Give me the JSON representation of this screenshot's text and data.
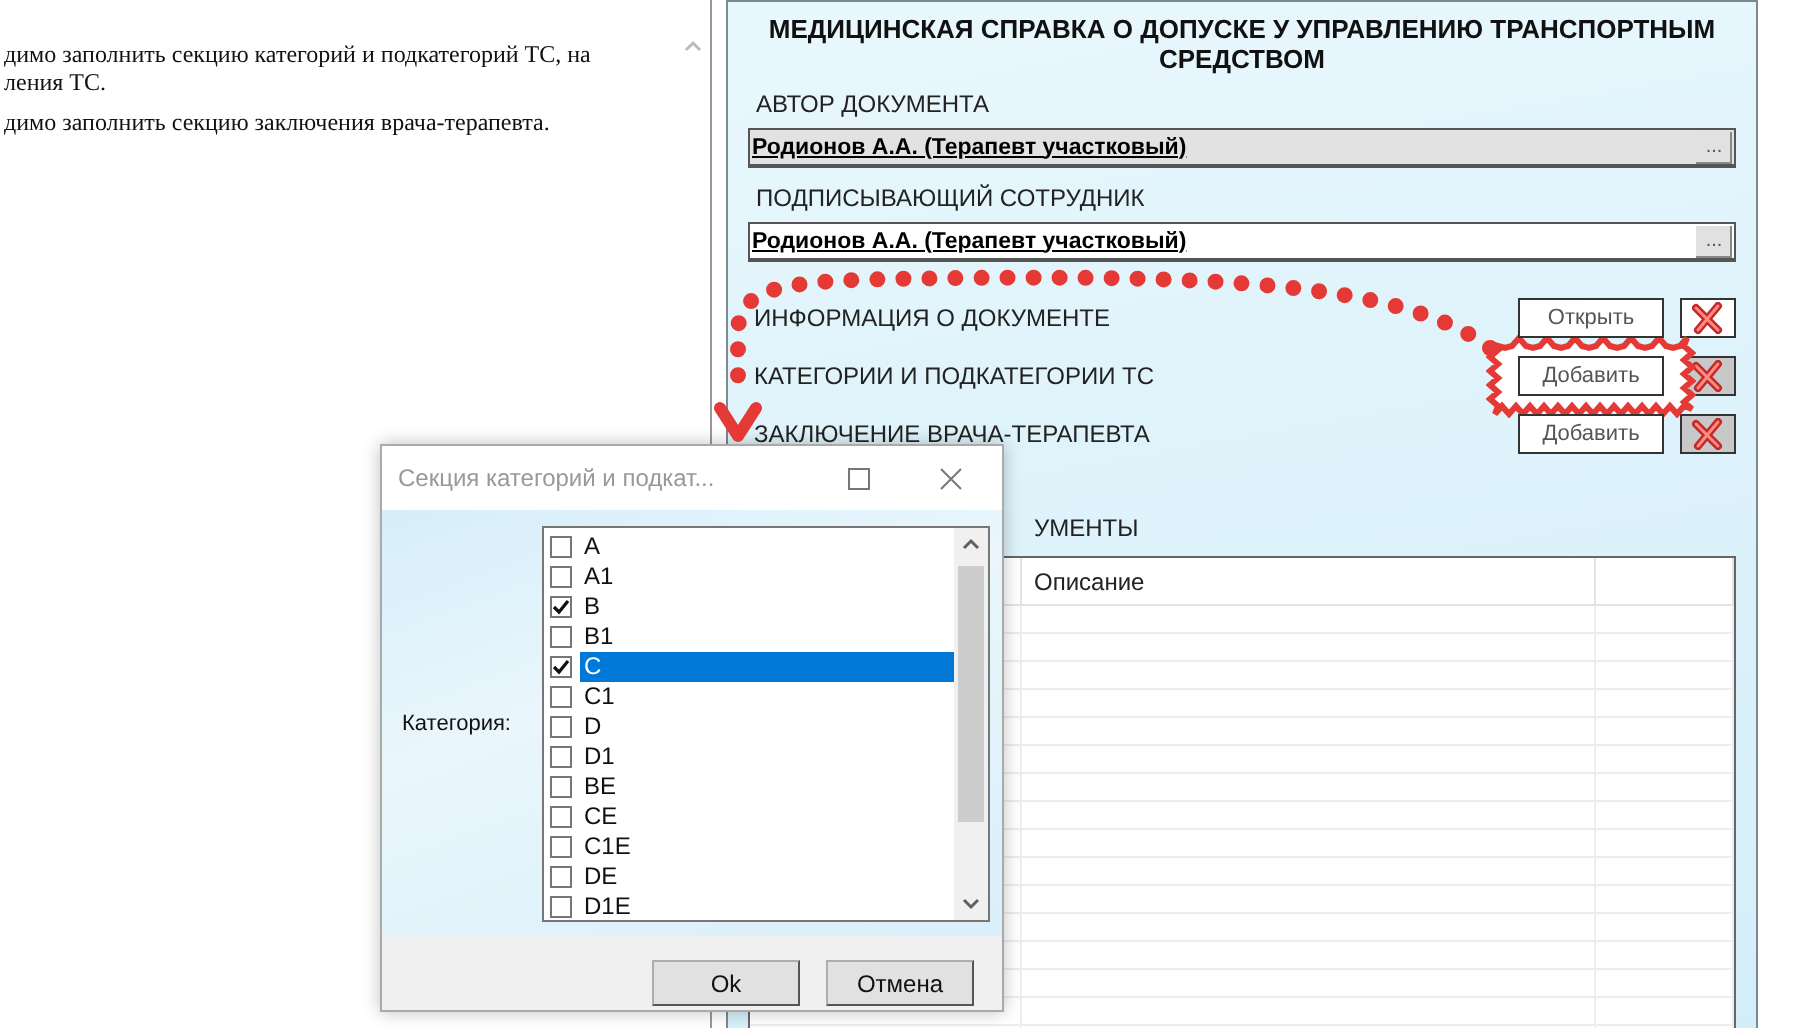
{
  "left_pane": {
    "lines": [
      "димо заполнить секцию категорий и подкатегорий ТС, на",
      "ления ТС.",
      "димо заполнить секцию заключения врача-терапевта."
    ]
  },
  "form": {
    "title": "МЕДИЦИНСКАЯ СПРАВКА О ДОПУСКЕ У УПРАВЛЕНИЮ ТРАНСПОРТНЫМ СРЕДСТВОМ",
    "fields": [
      {
        "label": "АВТОР ДОКУМЕНТА",
        "value": "Родионов А.А. (Терапевт участковый)",
        "button": "...",
        "disabled": true
      },
      {
        "label": "ПОДПИСЫВАЮЩИЙ СОТРУДНИК",
        "value": "Родионов А.А. (Терапевт участковый)",
        "button": "...",
        "disabled": false
      }
    ],
    "sections": [
      {
        "label": "ИНФОРМАЦИЯ О ДОКУМЕНТЕ",
        "action": "Открыть",
        "highlighted": false,
        "delete_disabled": false
      },
      {
        "label": "КАТЕГОРИИ И ПОДКАТЕГОРИИ ТС",
        "action": "Добавить",
        "highlighted": true,
        "delete_disabled": true
      },
      {
        "label": "ЗАКЛЮЧЕНИЕ ВРАЧА-ТЕРАПЕВТА",
        "action": "Добавить",
        "highlighted": false,
        "delete_disabled": true
      }
    ],
    "documents": {
      "heading": "УМЕНТЫ",
      "columns": [
        "Описание"
      ]
    }
  },
  "dialog": {
    "title": "Секция категорий и подкат...",
    "field_label": "Категория:",
    "items": [
      {
        "label": "A",
        "checked": false,
        "selected": false
      },
      {
        "label": "A1",
        "checked": false,
        "selected": false
      },
      {
        "label": "B",
        "checked": true,
        "selected": false
      },
      {
        "label": "B1",
        "checked": false,
        "selected": false
      },
      {
        "label": "C",
        "checked": true,
        "selected": true
      },
      {
        "label": "C1",
        "checked": false,
        "selected": false
      },
      {
        "label": "D",
        "checked": false,
        "selected": false
      },
      {
        "label": "D1",
        "checked": false,
        "selected": false
      },
      {
        "label": "BE",
        "checked": false,
        "selected": false
      },
      {
        "label": "CE",
        "checked": false,
        "selected": false
      },
      {
        "label": "C1E",
        "checked": false,
        "selected": false
      },
      {
        "label": "DE",
        "checked": false,
        "selected": false
      },
      {
        "label": "D1E",
        "checked": false,
        "selected": false
      }
    ],
    "buttons": [
      "Ok",
      "Отмена"
    ]
  }
}
